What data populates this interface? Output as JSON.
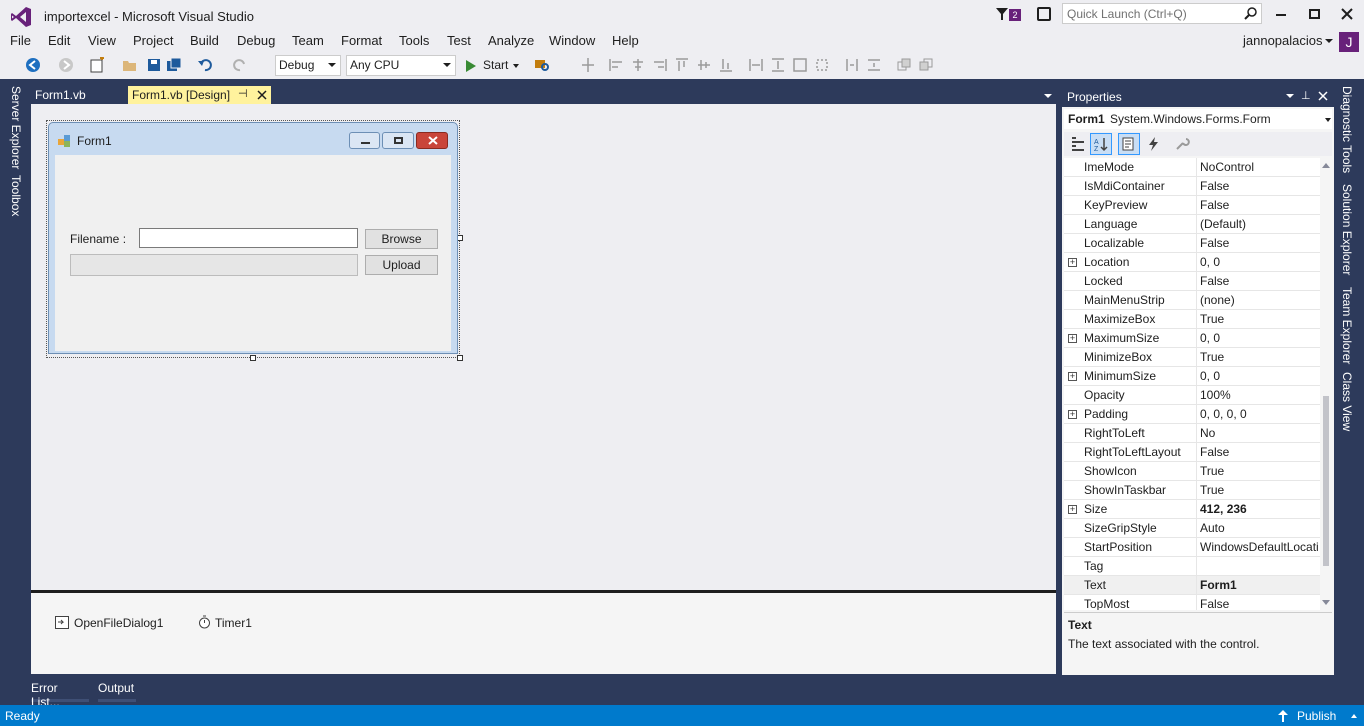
{
  "window": {
    "title": "importexcel - Microsoft Visual Studio",
    "user": "jannopalacios",
    "avatar_letter": "J",
    "notification_count": "2"
  },
  "quick_launch": {
    "placeholder": "Quick Launch (Ctrl+Q)"
  },
  "menu": [
    "File",
    "Edit",
    "View",
    "Project",
    "Build",
    "Debug",
    "Team",
    "Format",
    "Tools",
    "Test",
    "Analyze",
    "Window",
    "Help"
  ],
  "toolbar": {
    "config": "Debug",
    "platform": "Any CPU",
    "start_label": "Start"
  },
  "side_left": [
    "Server Explorer",
    "Toolbox"
  ],
  "side_right": [
    "Diagnostic Tools",
    "Solution Explorer",
    "Team Explorer",
    "Class View"
  ],
  "tabs": [
    {
      "label": "Form1.vb"
    },
    {
      "label": "Form1.vb [Design]"
    }
  ],
  "designer": {
    "form_title": "Form1",
    "filename_label": "Filename :",
    "filename_value": "",
    "browse_label": "Browse",
    "upload_label": "Upload"
  },
  "tray": [
    {
      "label": "OpenFileDialog1"
    },
    {
      "label": "Timer1"
    }
  ],
  "properties": {
    "title": "Properties",
    "object_name": "Form1",
    "object_type": "System.Windows.Forms.Form",
    "rows": [
      {
        "name": "ImeMode",
        "value": "NoControl"
      },
      {
        "name": "IsMdiContainer",
        "value": "False"
      },
      {
        "name": "KeyPreview",
        "value": "False"
      },
      {
        "name": "Language",
        "value": "(Default)"
      },
      {
        "name": "Localizable",
        "value": "False"
      },
      {
        "name": "Location",
        "value": "0, 0",
        "expandable": true
      },
      {
        "name": "Locked",
        "value": "False"
      },
      {
        "name": "MainMenuStrip",
        "value": "(none)"
      },
      {
        "name": "MaximizeBox",
        "value": "True"
      },
      {
        "name": "MaximumSize",
        "value": "0, 0",
        "expandable": true
      },
      {
        "name": "MinimizeBox",
        "value": "True"
      },
      {
        "name": "MinimumSize",
        "value": "0, 0",
        "expandable": true
      },
      {
        "name": "Opacity",
        "value": "100%"
      },
      {
        "name": "Padding",
        "value": "0, 0, 0, 0",
        "expandable": true
      },
      {
        "name": "RightToLeft",
        "value": "No"
      },
      {
        "name": "RightToLeftLayout",
        "value": "False"
      },
      {
        "name": "ShowIcon",
        "value": "True"
      },
      {
        "name": "ShowInTaskbar",
        "value": "True"
      },
      {
        "name": "Size",
        "value": "412, 236",
        "expandable": true,
        "bold": true
      },
      {
        "name": "SizeGripStyle",
        "value": "Auto"
      },
      {
        "name": "StartPosition",
        "value": "WindowsDefaultLocation"
      },
      {
        "name": "Tag",
        "value": ""
      },
      {
        "name": "Text",
        "value": "Form1",
        "bold": true
      },
      {
        "name": "TopMost",
        "value": "False"
      }
    ],
    "desc_title": "Text",
    "desc_text": "The text associated with the control."
  },
  "bottom_tabs": [
    "Error List...",
    "Output"
  ],
  "status": {
    "text": "Ready",
    "publish": "Publish"
  },
  "colors": {
    "accent": "#007acc",
    "vs_purple": "#68217a",
    "frame": "#2d3a5b"
  }
}
